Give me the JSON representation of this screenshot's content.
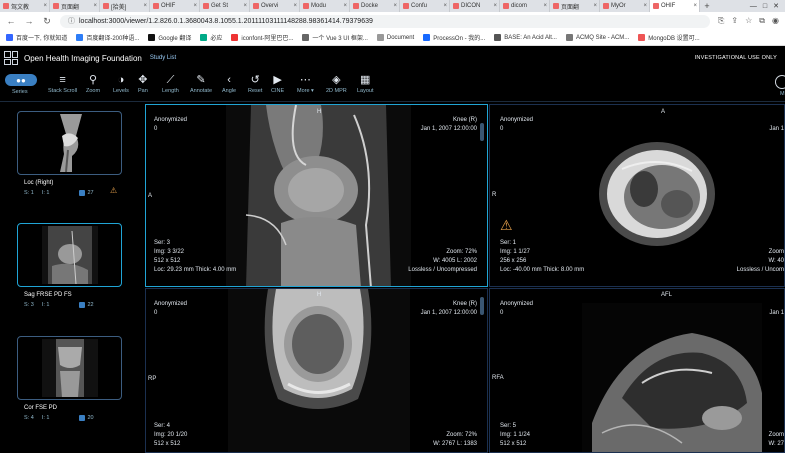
{
  "browser": {
    "tabs": [
      {
        "label": "驾文教",
        "active": false
      },
      {
        "label": "页面翻",
        "active": false
      },
      {
        "label": "[拾美]",
        "active": false
      },
      {
        "label": "OHIF",
        "active": false
      },
      {
        "label": "Get St",
        "active": false
      },
      {
        "label": "Overvi",
        "active": false
      },
      {
        "label": "Modu",
        "active": false
      },
      {
        "label": "Docke",
        "active": false
      },
      {
        "label": "Confu",
        "active": false
      },
      {
        "label": "DICON",
        "active": false
      },
      {
        "label": "dicom",
        "active": false
      },
      {
        "label": "页面翻",
        "active": false
      },
      {
        "label": "MyOr",
        "active": false
      },
      {
        "label": "OHIF",
        "active": true
      }
    ],
    "url": "localhost:3000/viewer/1.2.826.0.1.3680043.8.1055.1.20111103111148288.98361414.79379639",
    "bookmarks": [
      {
        "label": "百度一下, 你就知道",
        "color": "#3366ff"
      },
      {
        "label": "百度翻译-200种语...",
        "color": "#2d7df7"
      },
      {
        "label": "Google 翻译",
        "color": "#111"
      },
      {
        "label": "必应",
        "color": "#0a8"
      },
      {
        "label": "iconfont-阿里巴巴...",
        "color": "#e33"
      },
      {
        "label": "一个 Vue 3 UI 框架...",
        "color": "#666"
      },
      {
        "label": "Document",
        "color": "#999"
      },
      {
        "label": "ProcessOn - 我的...",
        "color": "#1769ff"
      },
      {
        "label": "BASE: An Acid Alt...",
        "color": "#555"
      },
      {
        "label": "ACMQ Site - ACM...",
        "color": "#777"
      },
      {
        "label": "MongoDB 设置可...",
        "color": "#e55"
      }
    ]
  },
  "header": {
    "brand": "Open Health Imaging Foundation",
    "study_list": "Study List",
    "notice": "INVESTIGATIONAL USE ONLY"
  },
  "toolbar": {
    "series_label": "Series",
    "tools": [
      {
        "label": "Stack Scroll",
        "icon": "≡"
      },
      {
        "label": "Zoom",
        "icon": "⚲"
      },
      {
        "label": "Levels",
        "icon": "◑"
      },
      {
        "label": "Pan",
        "icon": "✥"
      },
      {
        "label": "Length",
        "icon": "⟋"
      },
      {
        "label": "Annotate",
        "icon": "✎"
      },
      {
        "label": "Angle",
        "icon": "‹"
      },
      {
        "label": "Reset",
        "icon": "↺"
      },
      {
        "label": "CINE",
        "icon": "▶"
      },
      {
        "label": "More ▾",
        "icon": "⋯"
      },
      {
        "label": "2D MPR",
        "icon": "◈"
      },
      {
        "label": "Layout",
        "icon": "▦"
      }
    ],
    "right_label": "M"
  },
  "thumbnails": [
    {
      "title": "Loc (Right)",
      "s": "S: 1",
      "i": "I: 1",
      "count": "27",
      "warn": true
    },
    {
      "title": "Sag FRSE PD FS",
      "s": "S: 3",
      "i": "I: 1",
      "count": "22",
      "warn": false
    },
    {
      "title": "Cor FSE PD",
      "s": "S: 4",
      "i": "I: 1",
      "count": "20",
      "warn": false
    }
  ],
  "viewports": [
    {
      "tl1": "Anonymized",
      "tl2": "0",
      "tr1": "Knee (R)",
      "tr2": "Jan 1, 2007 12:00:00",
      "bl": [
        "Ser: 3",
        "Img: 3 3/22",
        "512 x 512",
        "Loc: 29.23 mm Thick: 4.00 mm"
      ],
      "br": [
        "Zoom: 72%",
        "W: 4005 L: 2002",
        "Lossless / Uncompressed"
      ],
      "top": "H",
      "left": "A"
    },
    {
      "tl1": "Anonymized",
      "tl2": "0",
      "tr1": "",
      "tr2": "Jan 1",
      "bl": [
        "Ser: 1",
        "Img: 1 1/27",
        "256 x 256",
        "Loc: -40.00 mm Thick: 8.00 mm"
      ],
      "br": [
        "Zoom",
        "W: 40",
        "Lossless / Uncom"
      ],
      "top": "A",
      "left": "R"
    },
    {
      "tl1": "Anonymized",
      "tl2": "0",
      "tr1": "Knee (R)",
      "tr2": "Jan 1, 2007 12:00:00",
      "bl": [
        "Ser: 4",
        "Img: 20 1/20",
        "512 x 512"
      ],
      "br": [
        "Zoom: 72%",
        "W: 2767 L: 1383"
      ],
      "top": "H",
      "left": "RP"
    },
    {
      "tl1": "Anonymized",
      "tl2": "0",
      "tr1": "",
      "tr2": "Jan 1",
      "bl": [
        "Ser: 5",
        "Img: 1 1/24",
        "512 x 512"
      ],
      "br": [
        "Zoom",
        "W: 27"
      ],
      "top": "AFL",
      "left": "RFA"
    }
  ]
}
